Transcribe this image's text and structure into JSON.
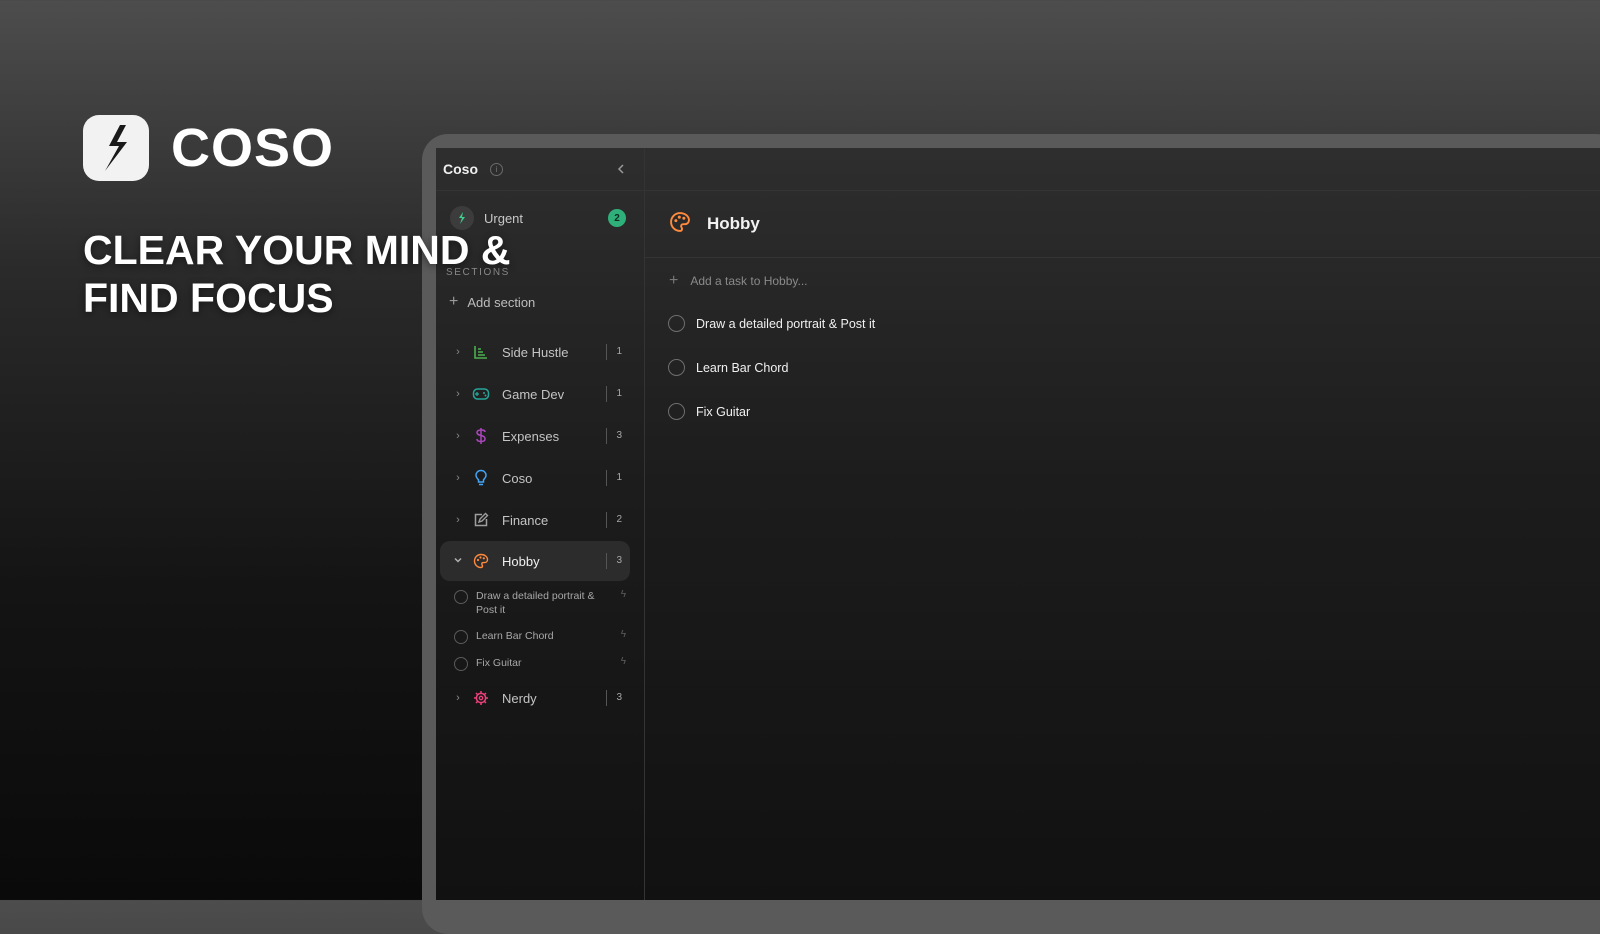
{
  "brand": {
    "name": "COSO",
    "tagline_line1": "CLEAR YOUR MIND &",
    "tagline_line2": "FIND FOCUS",
    "logo_icon": "bolt-logo-icon"
  },
  "sidebar": {
    "title": "Coso",
    "urgent": {
      "label": "Urgent",
      "count": "2"
    },
    "sections_label": "SECTIONS",
    "add_section_label": "Add section",
    "sections": [
      {
        "label": "Side Hustle",
        "count": "1",
        "icon": "chart-icon",
        "color": "#4caf50",
        "expanded": false
      },
      {
        "label": "Game Dev",
        "count": "1",
        "icon": "gamepad-icon",
        "color": "#26a69a",
        "expanded": false
      },
      {
        "label": "Expenses",
        "count": "3",
        "icon": "dollar-icon",
        "color": "#ab47bc",
        "expanded": false
      },
      {
        "label": "Coso",
        "count": "1",
        "icon": "lightbulb-icon",
        "color": "#42a5f5",
        "expanded": false
      },
      {
        "label": "Finance",
        "count": "2",
        "icon": "edit-icon",
        "color": "#9e9e9e",
        "expanded": false
      },
      {
        "label": "Hobby",
        "count": "3",
        "icon": "palette-icon",
        "color": "#ff8a3d",
        "expanded": true,
        "tasks": [
          {
            "label": "Draw a detailed portrait & Post it"
          },
          {
            "label": "Learn Bar Chord"
          },
          {
            "label": "Fix Guitar"
          }
        ]
      },
      {
        "label": "Nerdy",
        "count": "3",
        "icon": "gear-icon",
        "color": "#ec407a",
        "expanded": false
      }
    ]
  },
  "main": {
    "title": "Hobby",
    "icon": "palette-icon",
    "add_task_placeholder": "Add a task to Hobby...",
    "tasks": [
      {
        "label": "Draw a detailed portrait & Post it"
      },
      {
        "label": "Learn Bar Chord"
      },
      {
        "label": "Fix Guitar"
      }
    ]
  },
  "colors": {
    "accent_green": "#2fb07a",
    "hobby_orange": "#ff8a3d"
  }
}
